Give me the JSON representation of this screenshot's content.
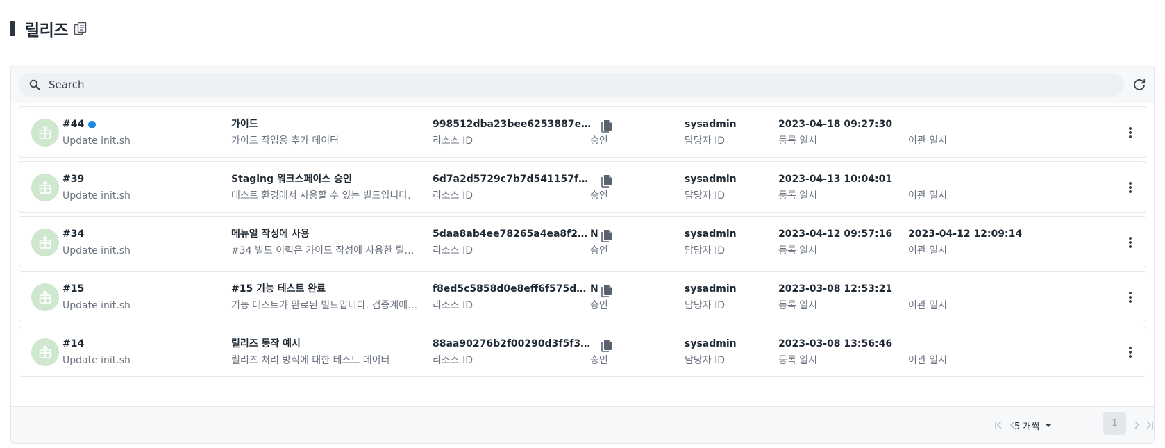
{
  "page": {
    "title": "릴리즈"
  },
  "search": {
    "placeholder": "Search",
    "value": ""
  },
  "columns": {
    "resource_id": "리소스 ID",
    "approval": "승인",
    "owner_id": "담당자 ID",
    "registered_at": "등록 일시",
    "migrated_at": "이관 일시"
  },
  "rows": [
    {
      "number": "#44",
      "new": true,
      "commit": "Update init.sh",
      "name": "가이드",
      "description": "가이드 작업용 추가 데이터",
      "resource_id": "998512dba23bee6253887e…",
      "approval": "",
      "owner": "sysadmin",
      "registered": "2023-04-18 09:27:30",
      "migrated": ""
    },
    {
      "number": "#39",
      "new": false,
      "commit": "Update init.sh",
      "name": "Staging 워크스페이스 승인",
      "description": "테스트 환경에서 사용할 수 있는 빌드입니다.",
      "resource_id": "6d7a2d5729c7b7d541157f…",
      "approval": "",
      "owner": "sysadmin",
      "registered": "2023-04-13 10:04:01",
      "migrated": ""
    },
    {
      "number": "#34",
      "new": false,
      "commit": "Update init.sh",
      "name": "메뉴얼 작성에 사용",
      "description": "#34 빌드 이력은 가이드 작성에 사용한 릴리즈입…",
      "resource_id": "5daa8ab4ee78265a4ea8f2…",
      "approval": "N",
      "owner": "sysadmin",
      "registered": "2023-04-12 09:57:16",
      "migrated": "2023-04-12 12:09:14"
    },
    {
      "number": "#15",
      "new": false,
      "commit": "Update init.sh",
      "name": "#15 기능 테스트 완료",
      "description": "기능 테스트가 완료된 빌드입니다. 검증계에서 …",
      "resource_id": "f8ed5c5858d0e8eff6f575d…",
      "approval": "N",
      "owner": "sysadmin",
      "registered": "2023-03-08 12:53:21",
      "migrated": ""
    },
    {
      "number": "#14",
      "new": false,
      "commit": "Update init.sh",
      "name": "릴리즈 동작 예시",
      "description": "릴리즈 처리 방식에 대한 테스트 데이터",
      "resource_id": "88aa90276b2f00290d3f5f3…",
      "approval": "",
      "owner": "sysadmin",
      "registered": "2023-03-08 13:56:46",
      "migrated": ""
    }
  ],
  "pagination": {
    "page_size_label": "5 개씩",
    "current_page": "1"
  },
  "colors": {
    "accent_dot": "#1e88e5",
    "avatar_bg": "#cfe6cf",
    "avatar_icon": "#ffffff"
  },
  "icons": {
    "title": "copy-icon",
    "search": "search-icon",
    "refresh": "refresh-icon",
    "row_avatar": "package-icon",
    "row_copy": "copy-icon",
    "row_menu": "more-vertical-icon"
  }
}
